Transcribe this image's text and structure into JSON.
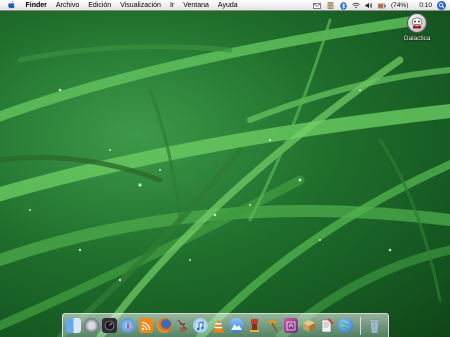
{
  "menubar": {
    "app_name": "Finder",
    "menus": [
      "Archivo",
      "Edición",
      "Visualización",
      "Ir",
      "Ventana",
      "Ayuda"
    ],
    "status": {
      "battery_text": "(74%)",
      "clock": "0:10"
    },
    "status_icons": [
      "mail-icon",
      "script-icon",
      "bluetooth-icon",
      "wifi-icon",
      "volume-icon",
      "battery-icon",
      "spotlight-icon"
    ]
  },
  "desktop": {
    "wallpaper": "grass-with-dew",
    "icons": [
      {
        "label": "Galactica",
        "icon": "hard-drive-icon"
      }
    ]
  },
  "dock": {
    "apps": [
      {
        "name": "finder-icon",
        "color": "#4a86d8"
      },
      {
        "name": "system-preferences-icon",
        "color": "#9aa0a8"
      },
      {
        "name": "dashboard-icon",
        "color": "#2f2f35"
      },
      {
        "name": "safari-icon",
        "color": "#5aa0e8"
      },
      {
        "name": "rss-icon",
        "color": "#f08a1e"
      },
      {
        "name": "firefox-icon",
        "color": "#e06a1a"
      },
      {
        "name": "automator-icon",
        "color": "#8a6a4a"
      },
      {
        "name": "itunes-icon",
        "color": "#7ab8e8"
      },
      {
        "name": "vlc-icon",
        "color": "#f08010"
      },
      {
        "name": "iphoto-icon",
        "color": "#3a7ac8"
      },
      {
        "name": "game-icon",
        "color": "#c83a2a"
      },
      {
        "name": "hammer-icon",
        "color": "#d8a020"
      },
      {
        "name": "photo-booth-icon",
        "color": "#a03a8a"
      },
      {
        "name": "package-icon",
        "color": "#c8a060"
      },
      {
        "name": "script-editor-icon",
        "color": "#d8d8d8"
      },
      {
        "name": "network-globe-icon",
        "color": "#3a88c8"
      }
    ],
    "trash": {
      "name": "trash-icon",
      "color": "#9ab0c8"
    }
  }
}
